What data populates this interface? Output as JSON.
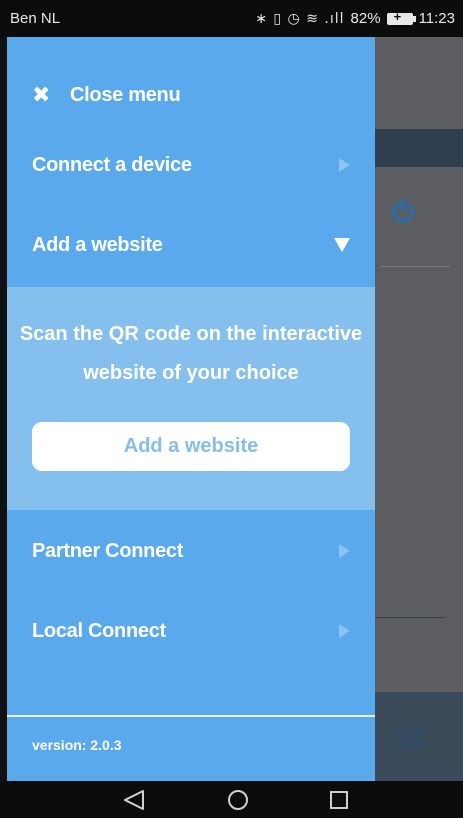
{
  "status_bar": {
    "carrier": "Ben NL",
    "icons": [
      "bluetooth-icon",
      "vibrate-icon",
      "alarm-icon",
      "wifi-icon",
      "signal-icon"
    ],
    "icons_text": "∗ ▯ ◷ ≋ .ıll",
    "battery_percent": "82%",
    "battery_level": 0.82,
    "time": "11:23"
  },
  "drawer": {
    "close_label": "Close menu",
    "items": [
      {
        "label": "Connect a device",
        "state": "collapsed"
      },
      {
        "label": "Add a website",
        "state": "expanded"
      },
      {
        "label": "Partner Connect",
        "state": "collapsed"
      },
      {
        "label": "Local Connect",
        "state": "collapsed"
      }
    ],
    "add_website_panel": {
      "instruction": "Scan the QR code on the interactive website of your choice",
      "button_label": "Add a website"
    },
    "version": "version: 2.0.3"
  },
  "colors": {
    "drawer_bg": "#5aa9ec",
    "panel_bg": "#85bfee",
    "button_text": "#85bdef",
    "background_app_accent": "#1e6fb8"
  },
  "navigation_bar": {
    "buttons": [
      "back-icon",
      "home-icon",
      "recent-apps-icon"
    ]
  }
}
